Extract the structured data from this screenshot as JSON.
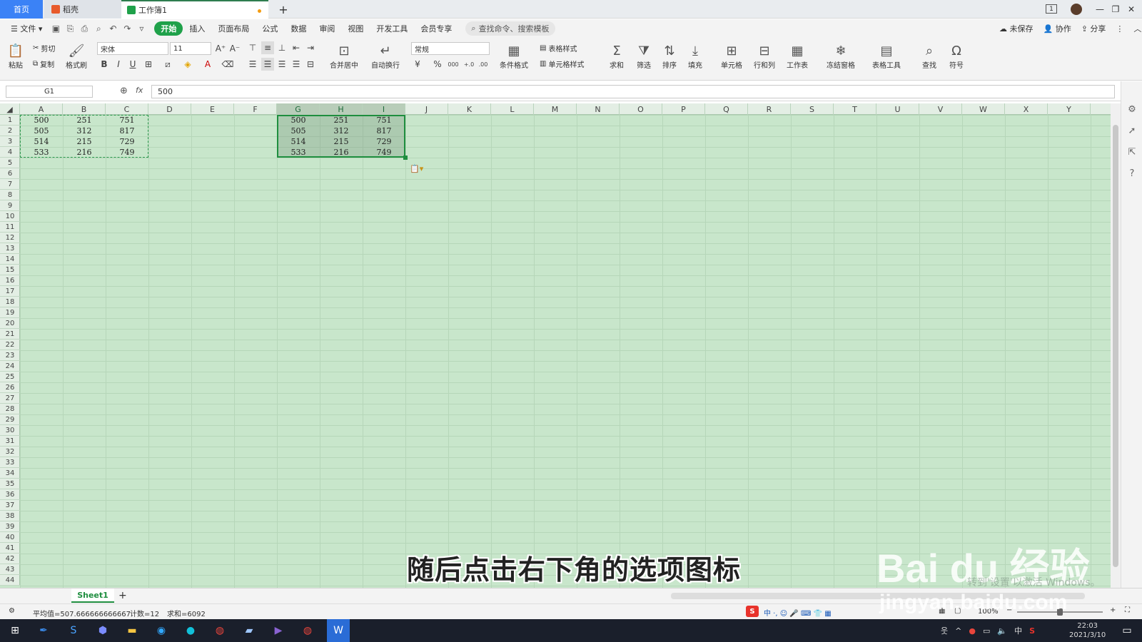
{
  "tabs": {
    "home": "首页",
    "shell": "稻壳",
    "workbook": "工作簿1",
    "add": "+"
  },
  "window": {
    "badge": "1",
    "min": "—",
    "restore": "❐",
    "close": "✕"
  },
  "menu": {
    "file": "文件",
    "items": [
      "开始",
      "插入",
      "页面布局",
      "公式",
      "数据",
      "审阅",
      "视图",
      "开发工具",
      "会员专享"
    ],
    "search": "查找命令、搜索模板",
    "unsaved": "未保存",
    "collab": "协作",
    "share": "分享"
  },
  "ribbon": {
    "paste": "粘贴",
    "cut": "剪切",
    "copy": "复制",
    "format_painter": "格式刷",
    "font": "宋体",
    "size": "11",
    "bold": "B",
    "italic": "I",
    "underline": "U",
    "merge": "合并居中",
    "wrap": "自动换行",
    "number_format": "常规",
    "currency": "¥",
    "percent": "%",
    "thousands": "000",
    "inc_dec": "+.0",
    "dec_dec": ".00",
    "cond_format": "条件格式",
    "table_style": "表格样式",
    "cell_style": "单元格样式",
    "sum": "求和",
    "filter": "筛选",
    "sort": "排序",
    "fill": "填充",
    "cell": "单元格",
    "rowcol": "行和列",
    "sheet": "工作表",
    "freeze": "冻结窗格",
    "table_tools": "表格工具",
    "find": "查找",
    "symbol": "符号"
  },
  "formula": {
    "name_box": "G1",
    "fx": "fx",
    "value": "500"
  },
  "columns": [
    "A",
    "B",
    "C",
    "D",
    "E",
    "F",
    "G",
    "H",
    "I",
    "J",
    "K",
    "L",
    "M",
    "N",
    "O",
    "P",
    "Q",
    "R",
    "S",
    "T",
    "U",
    "V",
    "W",
    "X",
    "Y"
  ],
  "rows": [
    "1",
    "2",
    "3",
    "4",
    "5",
    "6",
    "7",
    "8",
    "9",
    "10",
    "11",
    "12",
    "13",
    "14",
    "15",
    "16",
    "17",
    "18",
    "19",
    "20",
    "21",
    "22",
    "23",
    "24",
    "25",
    "26",
    "27",
    "28",
    "29",
    "30",
    "31",
    "32",
    "33",
    "34",
    "35",
    "36",
    "37",
    "38",
    "39",
    "40",
    "41",
    "42",
    "43",
    "44"
  ],
  "data": [
    [
      "500",
      "251",
      "751"
    ],
    [
      "505",
      "312",
      "817"
    ],
    [
      "514",
      "215",
      "729"
    ],
    [
      "533",
      "216",
      "749"
    ]
  ],
  "sheet": {
    "name": "Sheet1",
    "add": "+"
  },
  "status": {
    "avg": "平均值=507.666666666667",
    "count": "计数=12",
    "sum": "求和=6092",
    "zoom": "100%"
  },
  "subtitle": "随后点击右下角的选项图标",
  "watermark": {
    "brand": "Bai du 经验",
    "url": "jingyan.baidu.com",
    "activate": "转到'设置'以激活 Windows。"
  },
  "taskbar": {
    "time": "22:03",
    "date": "2021/3/10",
    "lang": "中"
  }
}
